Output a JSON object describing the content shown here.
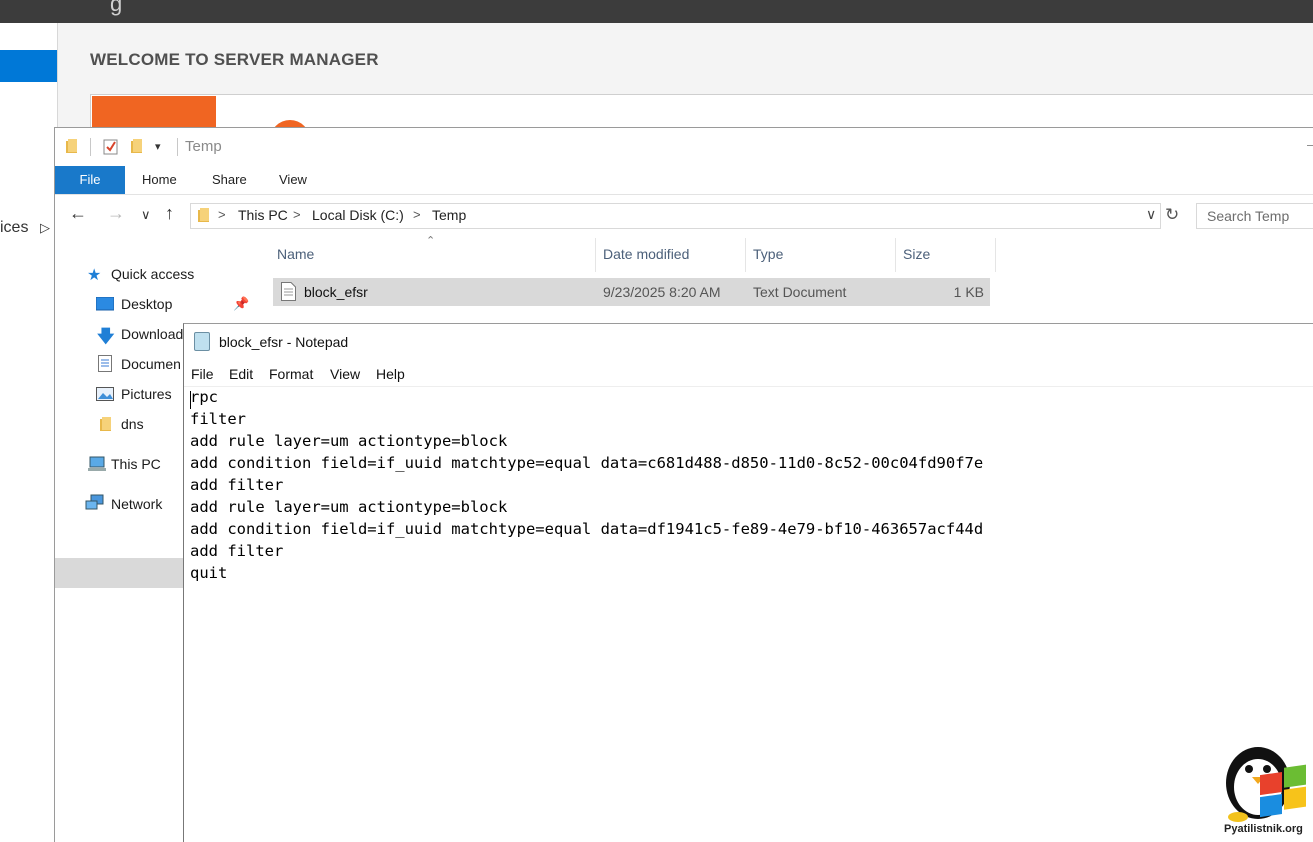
{
  "server_manager": {
    "left_partial_label": "ices",
    "welcome": "WELCOME TO SERVER MANAGER"
  },
  "explorer": {
    "title": "Temp",
    "ribbon_tabs": [
      "File",
      "Home",
      "Share",
      "View"
    ],
    "breadcrumb": [
      "This PC",
      "Local Disk (C:)",
      "Temp"
    ],
    "search_placeholder": "Search Temp",
    "nav_items": [
      {
        "label": "Quick access",
        "icon": "star-icon"
      },
      {
        "label": "Desktop",
        "icon": "desktop-icon"
      },
      {
        "label": "Download",
        "icon": "download-icon"
      },
      {
        "label": "Documen",
        "icon": "document-icon"
      },
      {
        "label": "Pictures",
        "icon": "pictures-icon"
      },
      {
        "label": "dns",
        "icon": "folder-icon"
      },
      {
        "label": "This PC",
        "icon": "computer-icon"
      },
      {
        "label": "Network",
        "icon": "network-icon"
      }
    ],
    "columns": [
      "Name",
      "Date modified",
      "Type",
      "Size"
    ],
    "files": [
      {
        "name": "block_efsr",
        "date": "9/23/2025 8:20 AM",
        "type": "Text Document",
        "size": "1 KB"
      }
    ]
  },
  "notepad": {
    "title": "block_efsr - Notepad",
    "menu": [
      "File",
      "Edit",
      "Format",
      "View",
      "Help"
    ],
    "lines": [
      "rpc",
      "filter",
      "add rule layer=um actiontype=block",
      "add condition field=if_uuid matchtype=equal data=c681d488-d850-11d0-8c52-00c04fd90f7e",
      "add filter",
      "add rule layer=um actiontype=block",
      "add condition field=if_uuid matchtype=equal data=df1941c5-fe89-4e79-bf10-463657acf44d",
      "add filter",
      "quit"
    ]
  },
  "watermark": {
    "text": "Pyatilistnik.org"
  }
}
